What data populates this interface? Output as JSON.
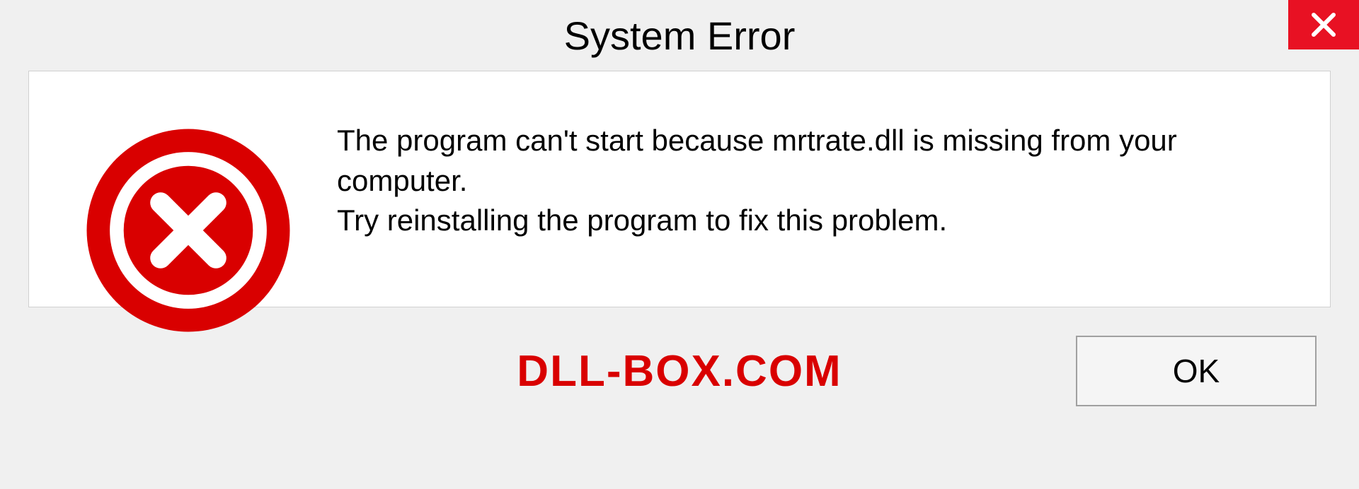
{
  "dialog": {
    "title": "System Error",
    "message_line1": "The program can't start because mrtrate.dll is missing from your computer.",
    "message_line2": "Try reinstalling the program to fix this problem.",
    "ok_label": "OK"
  },
  "watermark": "DLL-BOX.COM",
  "colors": {
    "close_button_bg": "#e81123",
    "error_icon": "#d90000",
    "watermark_text": "#d90000"
  }
}
